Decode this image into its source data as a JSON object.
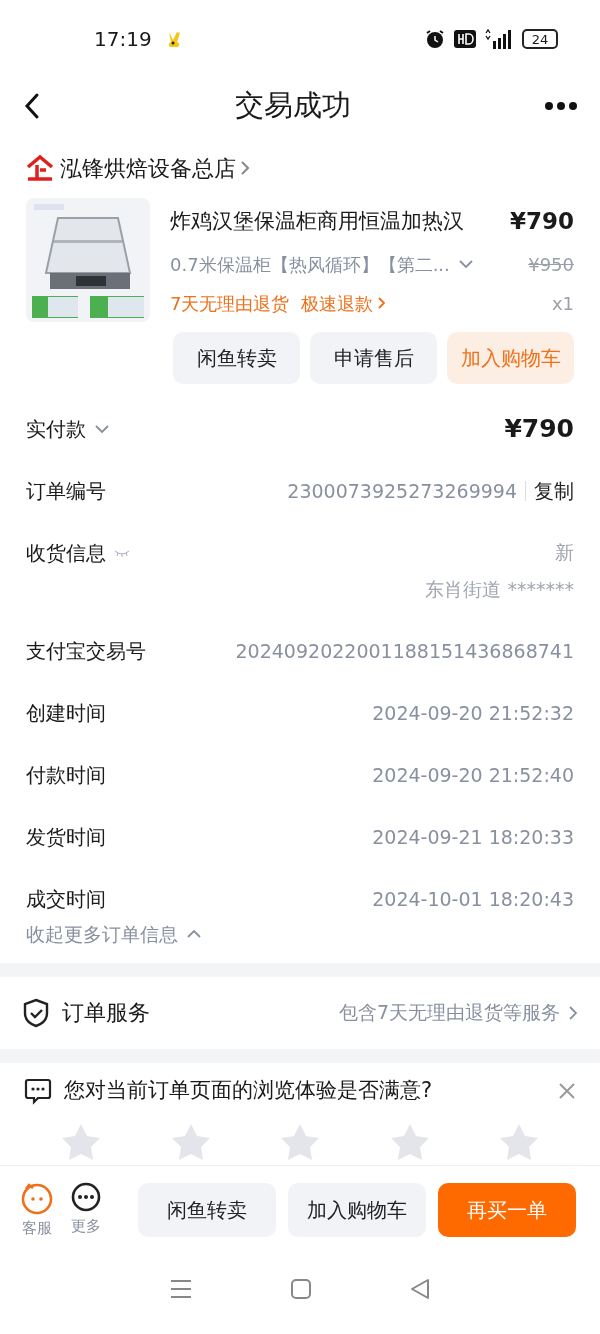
{
  "status_bar": {
    "time": "17:19",
    "battery": "24"
  },
  "header": {
    "title": "交易成功"
  },
  "shop": {
    "name": "泓锋烘焙设备总店"
  },
  "product": {
    "title": "炸鸡汉堡保温柜商用恒温加热汉",
    "price": "¥790",
    "spec": "0.7米保温柜【热风循环】【第二...",
    "original_price": "¥950",
    "tags": [
      "7天无理由退货",
      "极速退款"
    ],
    "quantity": "x1",
    "buttons": [
      {
        "label": "闲鱼转卖",
        "kind": "plain"
      },
      {
        "label": "申请售后",
        "kind": "plain"
      },
      {
        "label": "加入购物车",
        "kind": "accent"
      }
    ]
  },
  "paid": {
    "label": "实付款",
    "amount": "¥790"
  },
  "info_rows": [
    {
      "kind": "copy",
      "label": "订单编号",
      "value": "2300073925273269994",
      "action": "复制"
    },
    {
      "kind": "address",
      "label": "收货信息",
      "lines": [
        "新",
        "东肖街道 *******"
      ]
    },
    {
      "kind": "text",
      "label": "支付宝交易号",
      "value": "2024092022001188151436868741"
    },
    {
      "kind": "text",
      "label": "创建时间",
      "value": "2024-09-20 21:52:32"
    },
    {
      "kind": "text",
      "label": "付款时间",
      "value": "2024-09-20 21:52:40"
    },
    {
      "kind": "text",
      "label": "发货时间",
      "value": "2024-09-21 18:20:33"
    },
    {
      "kind": "text",
      "label": "成交时间",
      "value": "2024-10-01 18:20:43"
    }
  ],
  "collapse": {
    "label": "收起更多订单信息"
  },
  "service": {
    "title": "订单服务",
    "summary": "包含7天无理由退货等服务"
  },
  "survey": {
    "question": "您对当前订单页面的浏览体验是否满意?",
    "stars": 0
  },
  "bottom_bar": {
    "shortcuts": [
      {
        "kind": "service",
        "label": "客服"
      },
      {
        "kind": "more",
        "label": "更多"
      }
    ],
    "buttons": [
      {
        "label": "闲鱼转卖",
        "kind": "plain"
      },
      {
        "label": "加入购物车",
        "kind": "plain"
      },
      {
        "label": "再买一单",
        "kind": "primary"
      }
    ]
  }
}
